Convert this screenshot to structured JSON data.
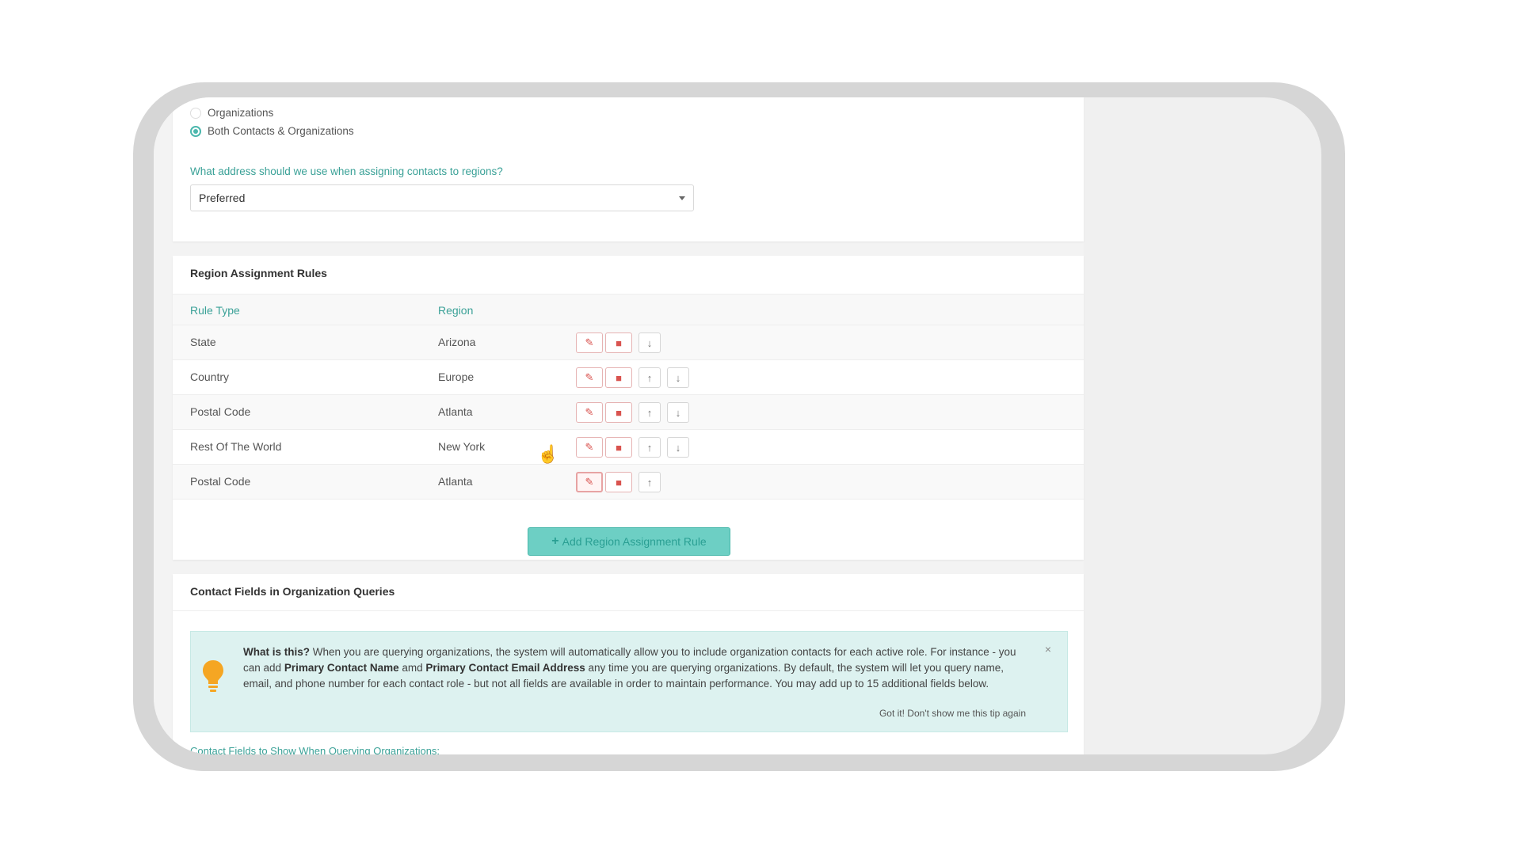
{
  "address_section": {
    "radio_organizations": "Organizations",
    "radio_both": "Both Contacts & Organizations",
    "question": "What address should we use when assigning contacts to regions?",
    "select_value": "Preferred"
  },
  "rules_section": {
    "title": "Region Assignment Rules",
    "columns": [
      "Rule Type",
      "Region"
    ],
    "rows": [
      {
        "rule_type": "State",
        "region": "Arizona"
      },
      {
        "rule_type": "Country",
        "region": "Europe"
      },
      {
        "rule_type": "Postal Code",
        "region": "Atlanta"
      },
      {
        "rule_type": "Rest Of The World",
        "region": "New York"
      },
      {
        "rule_type": "Postal Code",
        "region": "Atlanta"
      }
    ],
    "add_button": "Add Region Assignment Rule",
    "icons": [
      "pencil-icon",
      "trash-icon",
      "arrow-up-icon",
      "arrow-down-icon"
    ]
  },
  "contact_fields_section": {
    "title": "Contact Fields in Organization Queries",
    "tip": {
      "heading": "What is this?",
      "text_1": "When you are querying organizations, the system will automatically allow you to include organization contacts for each active role. For instance - you can add",
      "bold_1": "Primary Contact Name",
      "text_2": "amd",
      "bold_2": "Primary Contact Email Address",
      "text_3": "any time you are querying organizations. By default, the system will let you query name, email, and phone number for each contact role - but not all fields are available in order to maintain performance. You may add up to 15 additional fields below.",
      "dismiss": "Got it! Don't show me this tip again",
      "close": "×"
    },
    "fields_label": "Contact Fields to Show When Querying Organizations:"
  },
  "colors": {
    "accent": "#4bb7ad",
    "danger": "#d9534f",
    "tip_background": "#ddf2f0"
  }
}
